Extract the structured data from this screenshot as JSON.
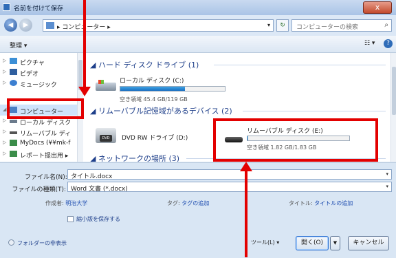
{
  "window": {
    "title": "名前を付けて保存",
    "close_label": "x"
  },
  "navbar": {
    "back_label": "◀",
    "forward_label": "▶",
    "address_text": "▸ コンピューター ▸",
    "address_dropdown": "▾",
    "refresh_label": "↻",
    "search_placeholder": "コンピューターの検索",
    "search_icon": "⌕"
  },
  "toolbar": {
    "organize_label": "整理 ▾",
    "view_label": "☷ ▾",
    "help_label": "?"
  },
  "nav_items": [
    {
      "label": "ピクチャ",
      "icon": "pictures-icon",
      "color": "#3c8fd6"
    },
    {
      "label": "ビデオ",
      "icon": "video-icon",
      "color": "#2f5f9f"
    },
    {
      "label": "ミュージック",
      "icon": "music-icon",
      "color": "#3c7fd0"
    },
    {
      "label": "コンピューター",
      "icon": "computer-icon",
      "color": "#4a7fc4",
      "selected": true
    },
    {
      "label": "ローカル ディスク",
      "icon": "local-disk-icon",
      "color": "#6b7b8c"
    },
    {
      "label": "リムーバブル ディ",
      "icon": "removable-disk-icon",
      "color": "#555555"
    },
    {
      "label": "MyDocs (¥¥mk-f",
      "icon": "network-drive-icon",
      "color": "#3b8d4a"
    },
    {
      "label": "レポート提出用 ▸",
      "icon": "network-drive-icon",
      "color": "#3b8d4a"
    }
  ],
  "groups": {
    "hdd": "ハード ディスク ドライブ (1)",
    "removable": "リムーバブル記憶域があるデバイス (2)",
    "network": "ネットワークの場所 (3)"
  },
  "drives": {
    "local": {
      "name": "ローカル ディスク (C:)",
      "free_text": "空き領域 45.4 GB/119 GB",
      "used_fraction": 0.62
    },
    "dvd": {
      "name": "DVD RW ドライブ (D:)"
    },
    "usb": {
      "name": "リムーバブル ディスク (E:)",
      "free_text": "空き領域 1.82 GB/1.83 GB",
      "used_fraction": 0.01
    }
  },
  "form": {
    "filename_label": "ファイル名(N):",
    "filename_value": "タイトル.docx",
    "filetype_label": "ファイルの種類(T):",
    "filetype_value": "Word 文書 (*.docx)",
    "author_label": "作成者:",
    "author_value": "明治大学",
    "tags_label": "タグ:",
    "tags_value": "タグの追加",
    "title_label": "タイトル:",
    "title_value": "タイトルの追加",
    "thumbnail_label": "縮小版を保存する",
    "hide_folders_label": "フォルダーの非表示",
    "tools_label": "ツール(L) ▾",
    "open_label": "開く(O)",
    "open_dropdown": "▼",
    "cancel_label": "キャンセル"
  },
  "colors": {
    "annotation": "#e30000",
    "accent": "#1e3f8a"
  }
}
